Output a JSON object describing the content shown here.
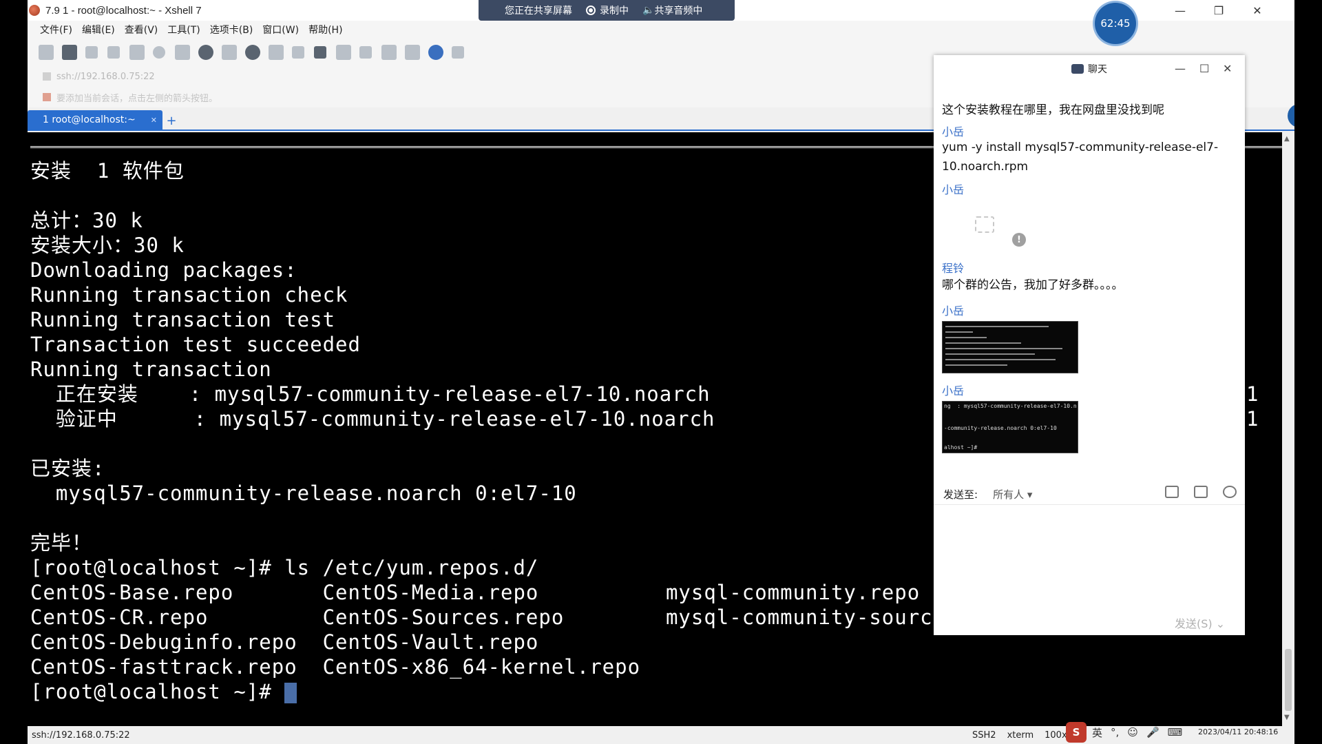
{
  "window": {
    "title": "7.9 1 - root@localhost:~ - Xshell 7",
    "minimize": "—",
    "maximize": "❐",
    "close": "✕"
  },
  "share_banner": {
    "sharing": "您正在共享屏幕",
    "recording": "录制中",
    "audio": "共享音频中"
  },
  "timer": "62:45",
  "menu": [
    "文件(F)",
    "编辑(E)",
    "查看(V)",
    "工具(T)",
    "选项卡(B)",
    "窗口(W)",
    "帮助(H)"
  ],
  "address": "ssh://192.168.0.75:22",
  "hint": "要添加当前会话，点击左侧的箭头按钮。",
  "tab": {
    "label": "1 root@localhost:~",
    "add": "+"
  },
  "terminal": {
    "lines": [
      "安装  1 软件包",
      "",
      "总计：30 k",
      "安装大小：30 k",
      "Downloading packages:",
      "Running transaction check",
      "Running transaction test",
      "Transaction test succeeded",
      "Running transaction",
      "  正在安装    : mysql57-community-release-el7-10.noarch",
      "  验证中      : mysql57-community-release-el7-10.noarch",
      "",
      "已安装:",
      "  mysql57-community-release.noarch 0:el7-10",
      "",
      "完毕！",
      "[root@localhost ~]# ls /etc/yum.repos.d/",
      "CentOS-Base.repo       CentOS-Media.repo          mysql-community.repo",
      "CentOS-CR.repo         CentOS-Sources.repo        mysql-community-source.",
      "CentOS-Debuginfo.repo  CentOS-Vault.repo",
      "CentOS-fasttrack.repo  CentOS-x86_64-kernel.repo",
      "[root@localhost ~]# "
    ],
    "right_digits": [
      "1",
      "1"
    ]
  },
  "statusbar": {
    "left": "ssh://192.168.0.75:22",
    "protocol": "SSH2",
    "term": "xterm",
    "size": "100x23",
    "ime": "英",
    "clock": "2023/04/11 20:48:16"
  },
  "chat": {
    "title": "聊天",
    "messages": [
      {
        "type": "text",
        "text": "这个安装教程在哪里，我在网盘里没找到呢"
      },
      {
        "type": "sender",
        "text": "小岳"
      },
      {
        "type": "text",
        "text": "yum -y install mysql57-community-release-el7-10.noarch.rpm"
      },
      {
        "type": "sender",
        "text": "小岳"
      },
      {
        "type": "sender",
        "text": "程铃"
      },
      {
        "type": "text",
        "text": "哪个群的公告，我加了好多群。。。。"
      },
      {
        "type": "sender",
        "text": "小岳"
      },
      {
        "type": "sender",
        "text": "小岳"
      }
    ],
    "thumb2_lines": [
      "ng  : mysql57-community-release-el7-10.n",
      "",
      "-community-release.noarch 0:el7-10",
      "",
      "alhost ~]# "
    ],
    "send_to_label": "发送至:",
    "send_to_target": "所有人",
    "send_button": "发送(S)"
  }
}
